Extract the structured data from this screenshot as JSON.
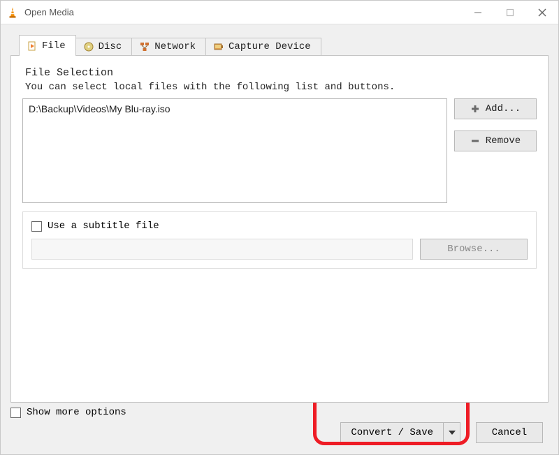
{
  "window": {
    "title": "Open Media"
  },
  "tabs": {
    "file": "File",
    "disc": "Disc",
    "network": "Network",
    "capture": "Capture Device"
  },
  "fileSelection": {
    "label": "File Selection",
    "hint": "You can select local files with the following list and buttons.",
    "item": "D:\\Backup\\Videos\\My Blu-ray.iso",
    "addLabel": "Add...",
    "removeLabel": "Remove"
  },
  "subtitle": {
    "label": "Use a subtitle file",
    "browseLabel": "Browse..."
  },
  "bottom": {
    "showMore": "Show more options"
  },
  "actions": {
    "convertSave": "Convert / Save",
    "cancel": "Cancel"
  }
}
